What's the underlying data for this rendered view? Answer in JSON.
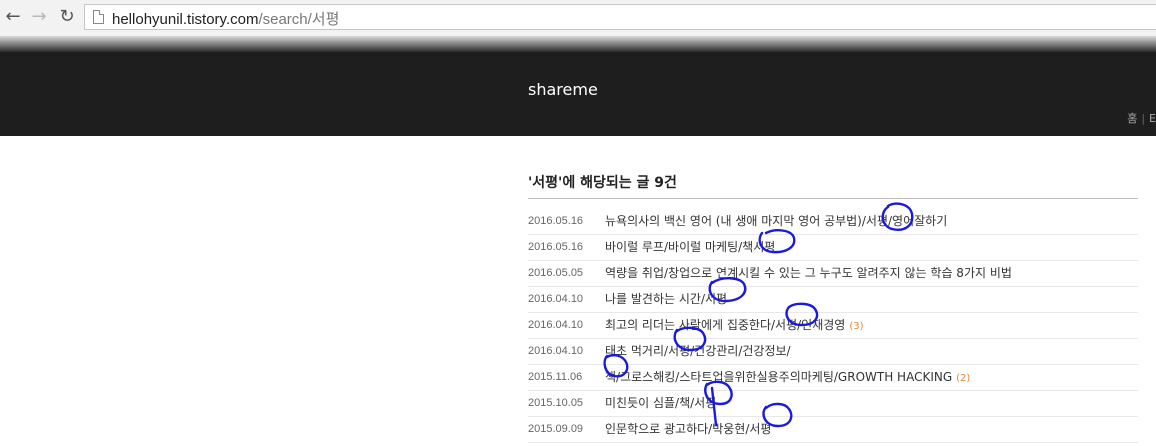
{
  "browser": {
    "url_host": "hellohyunil.tistory.com",
    "url_path": "/search/서평"
  },
  "blog": {
    "title": "shareme",
    "menu": [
      "홈",
      "E"
    ]
  },
  "search": {
    "heading": "'서평'에 해당되는 글 9건"
  },
  "posts": [
    {
      "date": "2016.05.16",
      "title": "뉴욕의사의 백신 영어 (내 생애 마지막 영어 공부법)/서평/영어잘하기",
      "comments": ""
    },
    {
      "date": "2016.05.16",
      "title": "바이럴 루프/바이럴 마케팅/책서평",
      "comments": ""
    },
    {
      "date": "2016.05.05",
      "title": "역량을 취업/창업으로 연계시킬 수 있는 그 누구도 알려주지 않는 학습 8가지 비법",
      "comments": ""
    },
    {
      "date": "2016.04.10",
      "title": "나를 발견하는 시간/서평",
      "comments": ""
    },
    {
      "date": "2016.04.10",
      "title": "최고의 리더는 사람에게 집중한다/서평/인재경영",
      "comments": "(3)"
    },
    {
      "date": "2016.04.10",
      "title": "태초 먹거리/서평/건강관리/건강정보/",
      "comments": ""
    },
    {
      "date": "2015.11.06",
      "title": "책/그로스해킹/스타트업을위한실용주의마케팅/GROWTH HACKING",
      "comments": "(2)"
    },
    {
      "date": "2015.10.05",
      "title": "미친듯이 심플/책/서평",
      "comments": ""
    },
    {
      "date": "2015.09.09",
      "title": "인문학으로 광고하다/박웅현/서평",
      "comments": ""
    }
  ]
}
